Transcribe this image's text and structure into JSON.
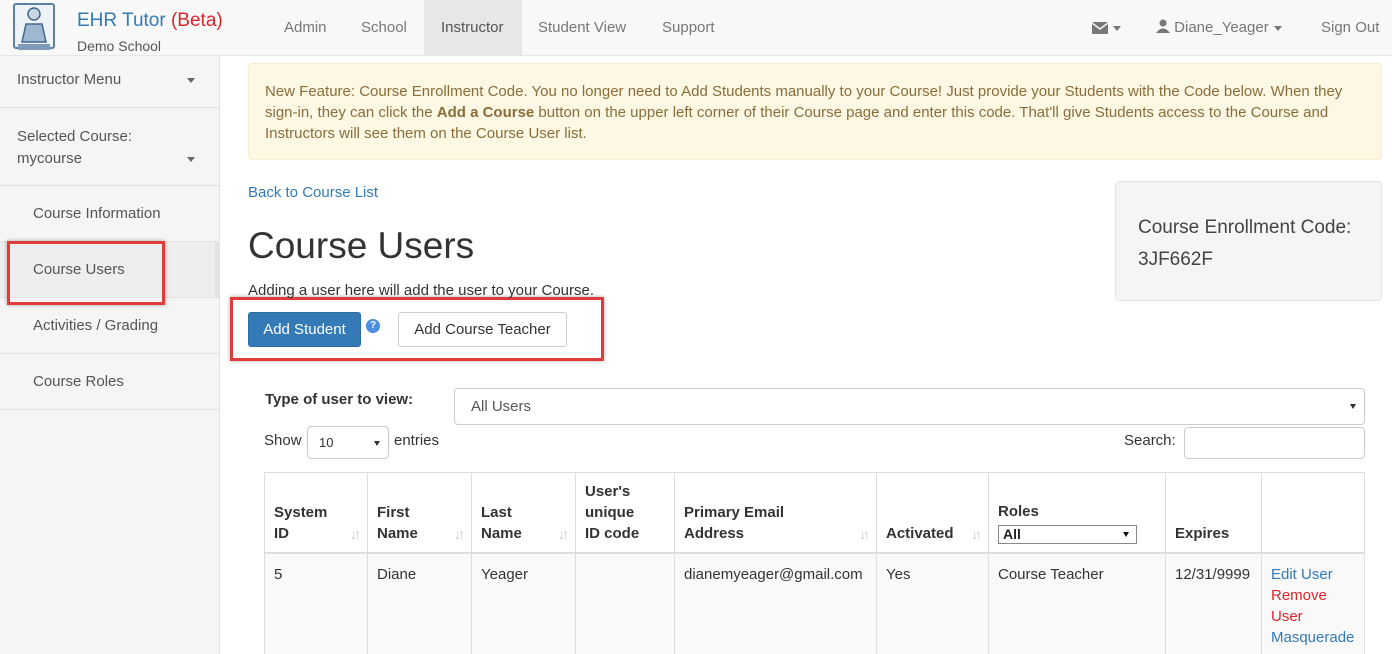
{
  "navbar": {
    "brand": "EHR Tutor",
    "beta": "(Beta)",
    "school": "Demo School",
    "items": [
      {
        "label": "Admin"
      },
      {
        "label": "School"
      },
      {
        "label": "Instructor"
      },
      {
        "label": "Student View"
      },
      {
        "label": "Support"
      }
    ],
    "active_item": "Instructor",
    "user": "Diane_Yeager",
    "signout": "Sign Out"
  },
  "sidebar": {
    "menu_label": "Instructor Menu",
    "selected_course_label": "Selected Course:",
    "selected_course_value": "mycourse",
    "items": [
      {
        "label": "Course Information"
      },
      {
        "label": "Course Users"
      },
      {
        "label": "Activities / Grading"
      },
      {
        "label": "Course Roles"
      }
    ],
    "active_item": "Course Users"
  },
  "alert": {
    "text_1": "New Feature: Course Enrollment Code. You no longer need to Add Students manually to your Course! Just provide your Students with the Code below. When they sign-in, they can click the ",
    "bold": "Add a Course",
    "text_2": " button on the upper left corner of their Course page and enter this code. That'll give Students access to the Course and Instructors will see them on the Course User list."
  },
  "main": {
    "back_link": "Back to Course List",
    "title": "Course Users",
    "subtext": "Adding a user here will add the user to your Course.",
    "add_student": "Add Student",
    "help_icon_glyph": "?",
    "add_teacher": "Add Course Teacher",
    "enrollment_label": "Course Enrollment Code:",
    "enrollment_code": "3JF662F",
    "filter_label": "Type of user to view:",
    "filter_value": "All Users",
    "show_label": "Show",
    "show_value": "10",
    "entries_label": "entries",
    "search_label": "Search:"
  },
  "table": {
    "headers": {
      "system_id": [
        "System",
        "ID"
      ],
      "first_name": [
        "First",
        "Name"
      ],
      "last_name": [
        "Last",
        "Name"
      ],
      "unique_code": [
        "User's",
        "unique",
        "ID code"
      ],
      "email": [
        "Primary Email",
        "Address"
      ],
      "activated": "Activated",
      "roles": "Roles",
      "roles_filter": "All",
      "expires": "Expires"
    },
    "rows": [
      {
        "system_id": "5",
        "first_name": "Diane",
        "last_name": "Yeager",
        "unique_code": "",
        "email": "dianemyeager@gmail.com",
        "activated": "Yes",
        "roles": "Course Teacher",
        "expires": "12/31/9999",
        "actions": {
          "edit": "Edit User",
          "remove_1": "Remove",
          "remove_2": "User",
          "masquerade": "Masquerade"
        }
      }
    ]
  },
  "colors": {
    "link": "#337ab7",
    "primary": "#337ab7",
    "danger": "#d9262b",
    "warning_bg": "#fcf8e3",
    "warning_text": "#8a6d3b",
    "highlight_box": "#e03c3c"
  },
  "icons": {
    "logo": "ehr-tutor-logo-icon",
    "mail": "envelope-icon",
    "user": "user-icon",
    "help": "question-circle-icon",
    "sort": "sort-arrows-icon"
  }
}
